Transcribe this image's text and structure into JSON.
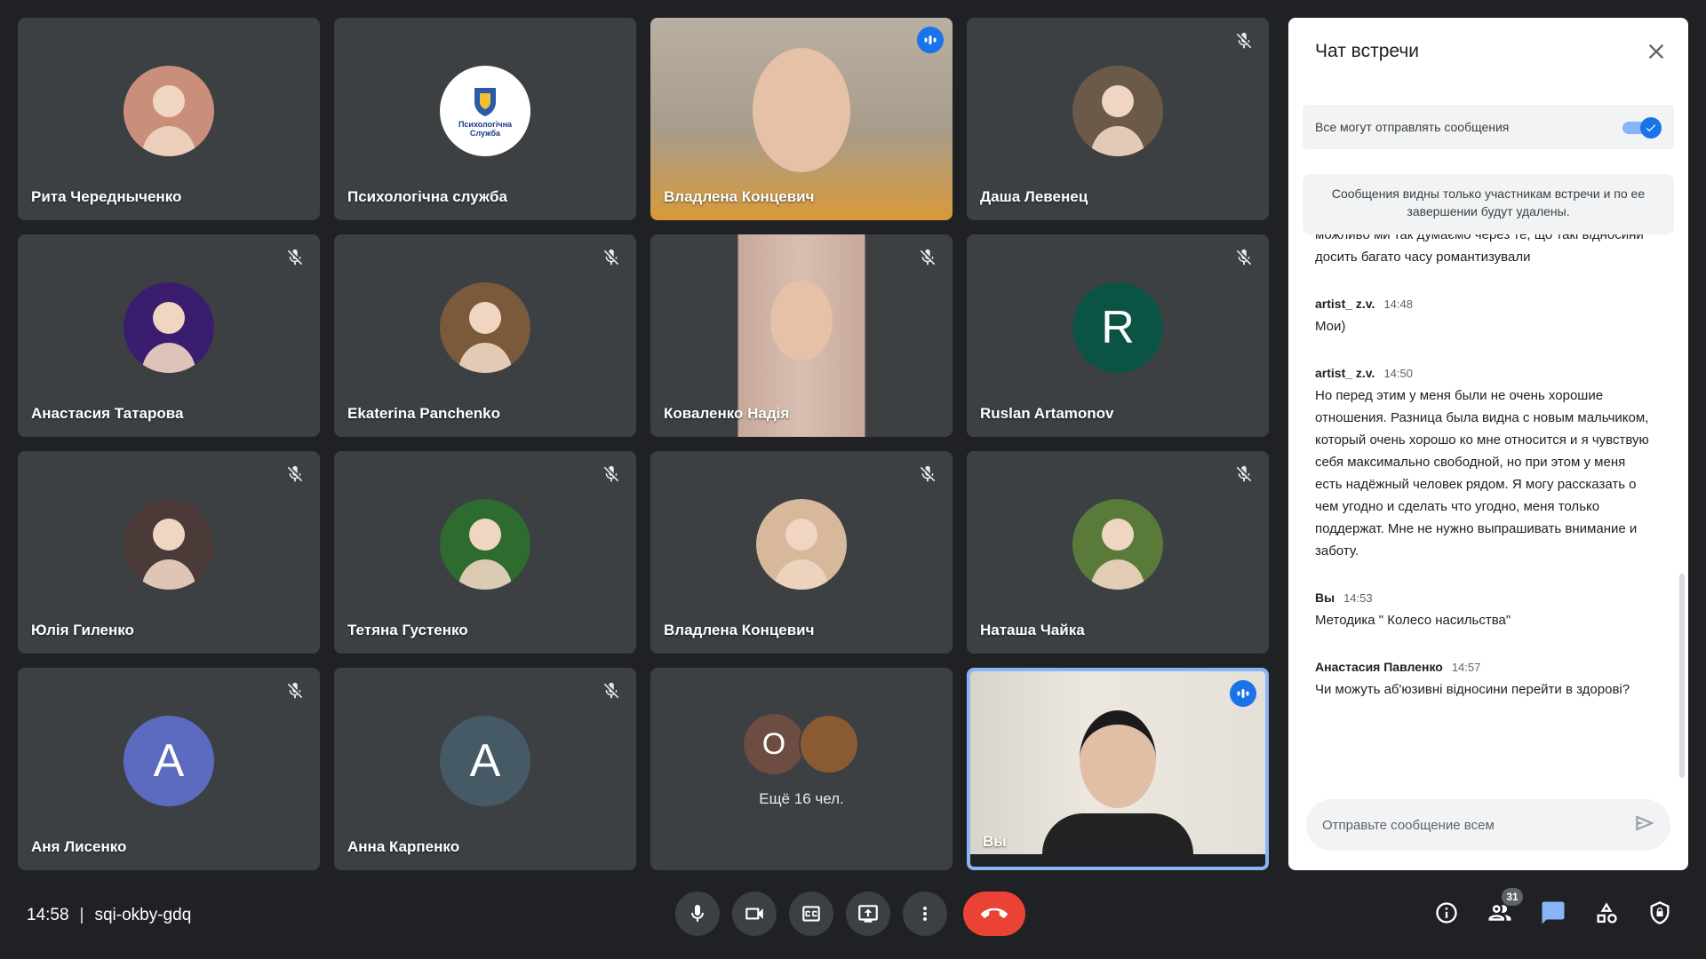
{
  "meeting": {
    "time": "14:58",
    "code": "sqi-okby-gdq"
  },
  "participants": [
    {
      "name": "Рита Чередныченко",
      "type": "photo",
      "muted": false,
      "color": "#c98f7a"
    },
    {
      "name": "Психологічна служба",
      "type": "logo",
      "muted": false,
      "logo_text": "Психологічна Служба"
    },
    {
      "name": "Владлена Концевич",
      "type": "video",
      "muted": false,
      "speaking": true
    },
    {
      "name": "Даша Левенец",
      "type": "photo",
      "muted": true,
      "color": "#6b5a4a"
    },
    {
      "name": "Анастасия Татарова",
      "type": "photo",
      "muted": true,
      "color": "#3a1d6e"
    },
    {
      "name": "Ekaterina Panchenko",
      "type": "photo",
      "muted": true,
      "color": "#7a5a3a"
    },
    {
      "name": "Коваленко Надія",
      "type": "video",
      "muted": true
    },
    {
      "name": "Ruslan Artamonov",
      "type": "letter",
      "muted": true,
      "letter": "R",
      "color": "#0b5345"
    },
    {
      "name": "Юлія Гиленко",
      "type": "photo",
      "muted": true,
      "color": "#4a3a38"
    },
    {
      "name": "Тетяна Густенко",
      "type": "photo",
      "muted": true,
      "color": "#2d6b2e"
    },
    {
      "name": "Владлена Концевич",
      "type": "photo",
      "muted": true,
      "color": "#d8b89a"
    },
    {
      "name": "Наташа Чайка",
      "type": "photo",
      "muted": true,
      "color": "#5a7a3a"
    },
    {
      "name": "Аня Лисенко",
      "type": "letter",
      "muted": true,
      "letter": "А",
      "color": "#5c6bc0"
    },
    {
      "name": "Анна Карпенко",
      "type": "letter",
      "muted": true,
      "letter": "А",
      "color": "#455a64"
    }
  ],
  "more": {
    "label": "Ещё 16 чел.",
    "letter": "О",
    "letter_color": "#6d4c41"
  },
  "self": {
    "name": "Вы",
    "speaking": true
  },
  "chat": {
    "title": "Чат встречи",
    "toggle_label": "Все могут отправлять сообщения",
    "toggle_on": true,
    "notice": "Сообщения видны только участникам встречи и по ее завершении будут удалены.",
    "cut_text": "можливо ми так думаємо через те, що такі відносини досить багато часу романтизували",
    "messages": [
      {
        "sender": "artist_ z.v.",
        "time": "14:48",
        "text": "Мои)"
      },
      {
        "sender": "artist_ z.v.",
        "time": "14:50",
        "text": "Но перед этим у меня были не очень хорошие отношения. Разница была видна с новым мальчиком, который очень хорошо ко мне относится и я чувствую себя максимально свободной, но при этом у меня есть надёжный человек рядом. Я могу рассказать о чем угодно и сделать что угодно, меня только поддержат. Мне не нужно выпрашивать внимание и заботу."
      },
      {
        "sender": "Вы",
        "time": "14:53",
        "text": "Методика \" Колесо насильства\""
      },
      {
        "sender": "Анастасия Павленко",
        "time": "14:57",
        "text": "Чи можуть аб'юзивні відносини перейти в здорові?"
      }
    ],
    "input_placeholder": "Отправьте сообщение всем"
  },
  "toolbar": {
    "people_count": "31"
  },
  "colors": {
    "accent": "#1a73e8",
    "end_call": "#ea4335",
    "tile_bg": "#3c4043",
    "bg": "#202124"
  }
}
